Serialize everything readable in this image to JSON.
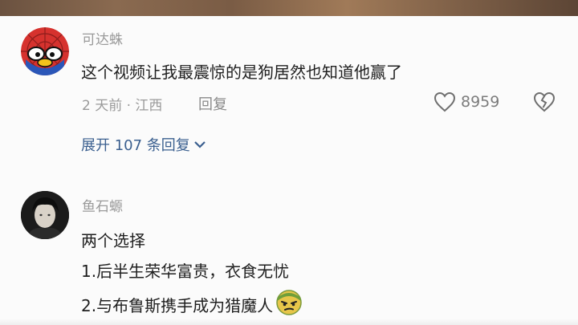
{
  "comments": [
    {
      "username": "可达蛛",
      "text": "这个视频让我最震惊的是狗居然也知道他赢了",
      "meta": "2 天前 · 江西",
      "reply_label": "回复",
      "likes": "8959",
      "expand_label": "展开 107 条回复"
    },
    {
      "username": "鱼石螈",
      "lines": [
        "两个选择",
        "1.后半生荣华富贵，衣食无忧",
        "2.与布鲁斯携手成为猎魔人"
      ]
    }
  ],
  "icons": {
    "like": "heart-icon",
    "dislike": "broken-heart-icon",
    "expand": "chevron-down-icon",
    "emoji": "smirk-emoji-icon"
  },
  "colors": {
    "link": "#3a5f8f",
    "muted": "#9a9a9a",
    "text": "#1f1f1f"
  }
}
